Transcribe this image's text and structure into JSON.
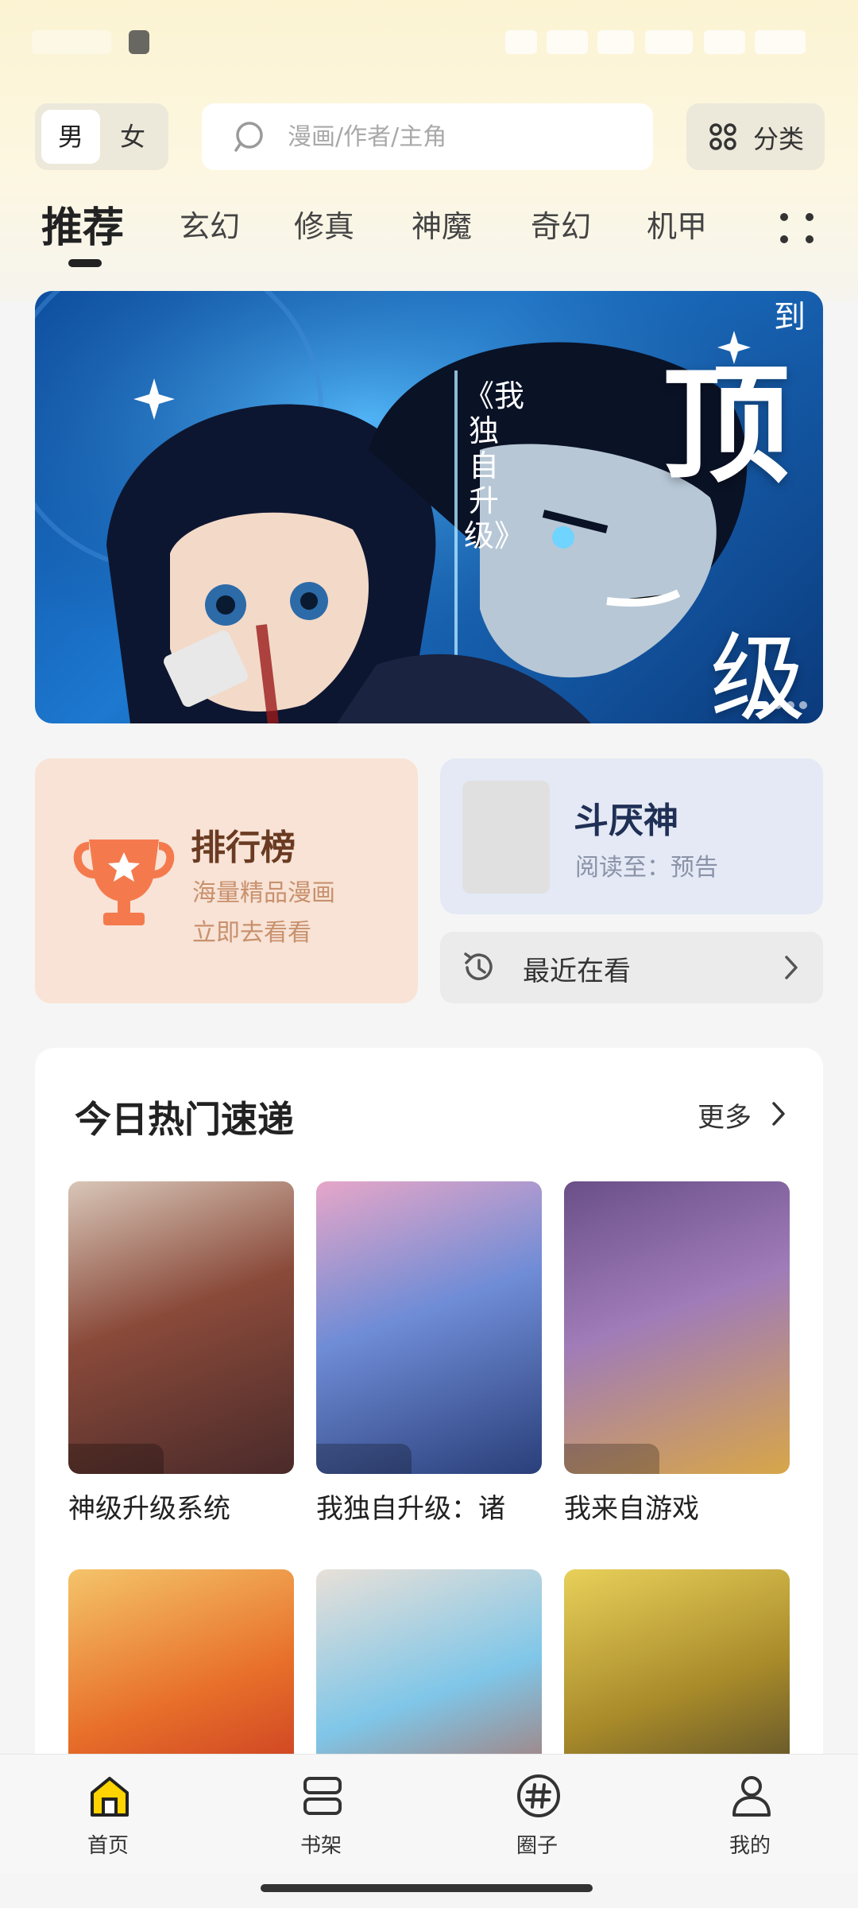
{
  "header": {
    "gender_male": "男",
    "gender_female": "女",
    "search_placeholder": "漫画/作者/主角",
    "category_label": "分类"
  },
  "tabs": [
    "推荐",
    "玄幻",
    "修真",
    "神魔",
    "奇幻",
    "机甲"
  ],
  "banner": {
    "vertical_title": "《我独自升级》",
    "big_char_1": "顶",
    "big_char_2": "级",
    "top_char": "到",
    "slide_count": 4,
    "active_slide": 1
  },
  "rank_card": {
    "title": "排行榜",
    "line1": "海量精品漫画",
    "line2": "立即去看看"
  },
  "last_read": {
    "title": "斗厌神",
    "subtitle": "阅读至：预告"
  },
  "recent": {
    "label": "最近在看"
  },
  "hot_section": {
    "title": "今日热门速递",
    "more_label": "更多",
    "comics": [
      {
        "title": "神级升级系统",
        "colors": [
          "#4a2a2a",
          "#8a4a3a",
          "#d8c6b8"
        ]
      },
      {
        "title": "我独自升级：诸",
        "colors": [
          "#2a3f7a",
          "#6f8cd6",
          "#e6a6c8"
        ]
      },
      {
        "title": "我来自游戏",
        "colors": [
          "#d8a648",
          "#a07cb8",
          "#6a4f88"
        ]
      },
      {
        "title": "",
        "colors": [
          "#b81e1e",
          "#e8702a",
          "#f4c46a"
        ]
      },
      {
        "title": "",
        "colors": [
          "#c04a2a",
          "#7fc6e8",
          "#e8e0d8"
        ]
      },
      {
        "title": "",
        "colors": [
          "#2a2a2a",
          "#a88a2a",
          "#e8d05a"
        ]
      }
    ]
  },
  "bottom_nav": [
    {
      "label": "首页",
      "icon": "home-icon"
    },
    {
      "label": "书架",
      "icon": "bookshelf-icon"
    },
    {
      "label": "圈子",
      "icon": "hashtag-icon"
    },
    {
      "label": "我的",
      "icon": "profile-icon"
    }
  ],
  "colors": {
    "accent_yellow": "#ffd400",
    "rank_bg": "#f8e3d6",
    "rank_title": "#6a3b22",
    "trophy": "#f47a4e",
    "last_read_bg": "#e4e9f5"
  }
}
